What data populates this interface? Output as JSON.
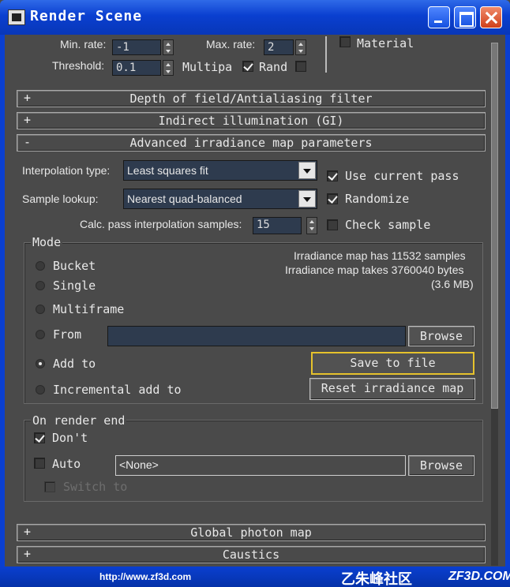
{
  "window": {
    "title": "Render Scene"
  },
  "top_section": {
    "min_rate_label": "Min. rate:",
    "min_rate_value": "-1",
    "max_rate_label": "Max. rate:",
    "max_rate_value": "2",
    "threshold_label": "Threshold:",
    "threshold_value": "0.1",
    "multipass_label": "Multipa",
    "multipass_checked": true,
    "randomize_label": "Rand",
    "randomize_checked": false,
    "material_label": "Material"
  },
  "rollouts": {
    "dof": {
      "sign": "+",
      "title": "Depth of field/Antialiasing filter"
    },
    "gi": {
      "sign": "+",
      "title": "Indirect illumination (GI)"
    },
    "advanced": {
      "sign": "-",
      "title": "Advanced irradiance map parameters"
    },
    "photon": {
      "sign": "+",
      "title": "Global photon map"
    },
    "caustics": {
      "sign": "+",
      "title": "Caustics"
    }
  },
  "advanced": {
    "interp_type_label": "Interpolation type:",
    "interp_type_value": "Least squares fit",
    "sample_lookup_label": "Sample lookup:",
    "sample_lookup_value": "Nearest quad-balanced",
    "calc_pass_label": "Calc. pass interpolation samples:",
    "calc_pass_value": "15",
    "use_current_pass_label": "Use current pass",
    "use_current_pass_checked": true,
    "randomize_label": "Randomize",
    "randomize_checked": true,
    "check_sample_label": "Check sample",
    "check_sample_checked": false
  },
  "mode": {
    "group_label": "Mode",
    "options": {
      "bucket": "Bucket",
      "single": "Single",
      "multiframe": "Multiframe",
      "from": "From",
      "add_to": "Add to",
      "incremental": "Incremental add to"
    },
    "selected": "add_to",
    "from_path": "",
    "browse_label": "Browse",
    "info_samples": "Irradiance map has 11532 samples",
    "info_bytes": "Irradiance map takes 3760040 bytes",
    "info_mb": "(3.6 MB)",
    "save_label": "Save to file",
    "reset_label": "Reset irradiance map"
  },
  "render_end": {
    "group_label": "On render end",
    "dont_delete_label": "Don't",
    "dont_delete_checked": true,
    "auto_save_label": "Auto",
    "auto_save_checked": false,
    "auto_save_path": "<None>",
    "browse_label": "Browse",
    "switch_label": "Switch to",
    "switch_checked": false
  },
  "footer": {
    "url": "http://www.zf3d.com",
    "brand": "乙朱峰社区",
    "site": "ZF3D.COM"
  }
}
